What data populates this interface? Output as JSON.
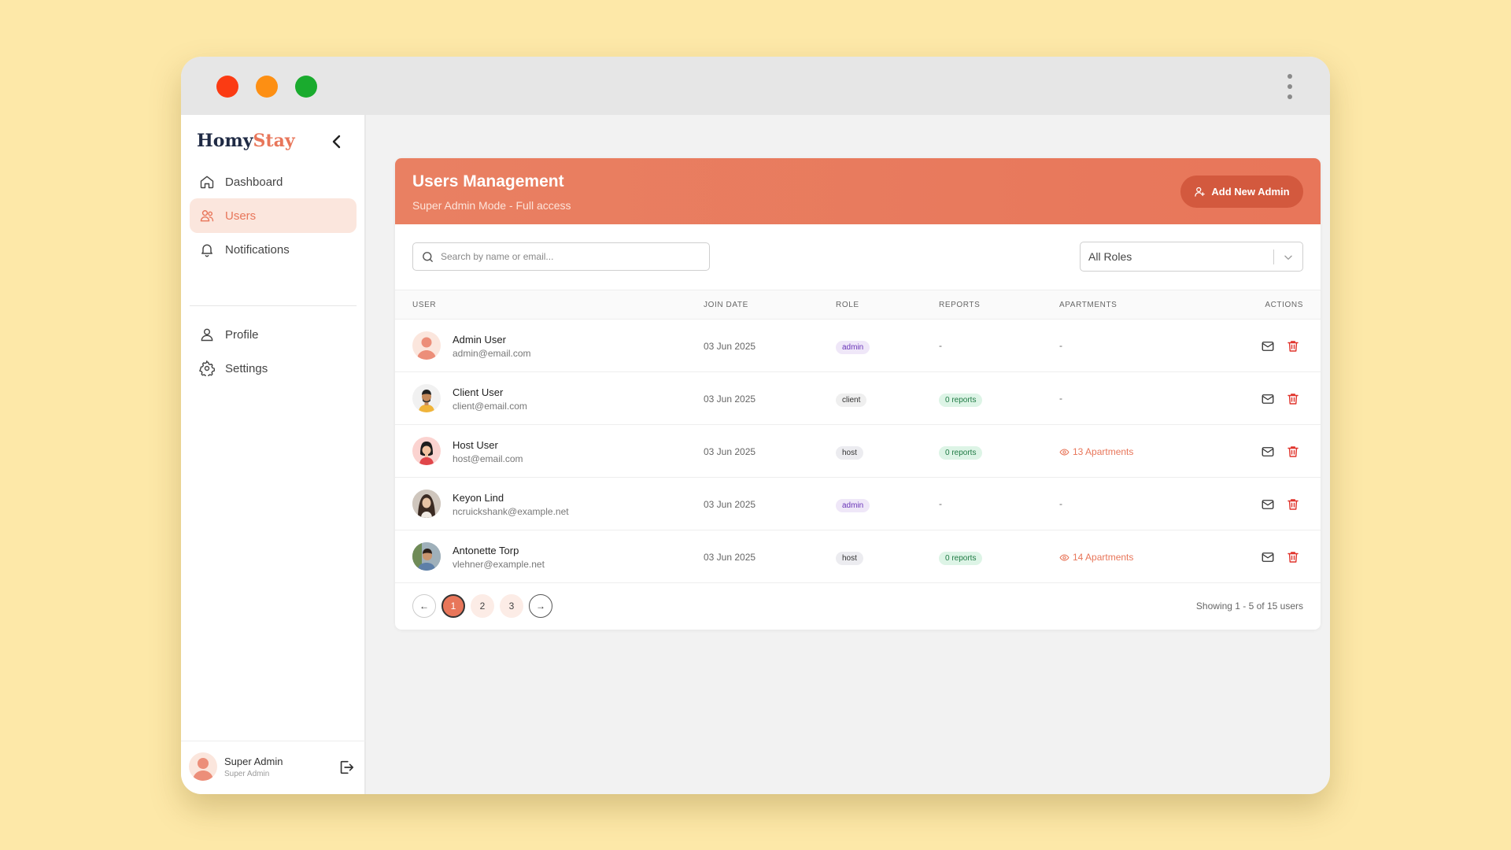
{
  "window": {
    "dots": [
      "red",
      "orange",
      "green"
    ]
  },
  "sidebar": {
    "logo_a": "Homy",
    "logo_b": "Stay",
    "items": [
      {
        "label": "Dashboard",
        "icon": "home-icon"
      },
      {
        "label": "Users",
        "icon": "users-icon",
        "active": true
      },
      {
        "label": "Notifications",
        "icon": "bell-icon"
      },
      {
        "label": "Profile",
        "icon": "user-icon"
      },
      {
        "label": "Settings",
        "icon": "gear-icon"
      }
    ],
    "footer": {
      "name": "Super Admin",
      "role": "Super Admin"
    }
  },
  "header": {
    "title": "Users Management",
    "subtitle": "Super Admin Mode - Full access",
    "add_button": "Add New Admin"
  },
  "filters": {
    "search_placeholder": "Search by name or email...",
    "role_select": "All Roles"
  },
  "table": {
    "columns": [
      "USER",
      "JOIN DATE",
      "ROLE",
      "REPORTS",
      "APARTMENTS",
      "ACTIONS"
    ],
    "rows": [
      {
        "name": "Admin User",
        "email": "admin@email.com",
        "join": "03 Jun 2025",
        "role": "admin",
        "reports": "-",
        "apartments": "-"
      },
      {
        "name": "Client User",
        "email": "client@email.com",
        "join": "03 Jun 2025",
        "role": "client",
        "reports": "0 reports",
        "apartments": "-"
      },
      {
        "name": "Host User",
        "email": "host@email.com",
        "join": "03 Jun 2025",
        "role": "host",
        "reports": "0 reports",
        "apartments": "13 Apartments"
      },
      {
        "name": "Keyon Lind",
        "email": "ncruickshank@example.net",
        "join": "03 Jun 2025",
        "role": "admin",
        "reports": "-",
        "apartments": "-"
      },
      {
        "name": "Antonette Torp",
        "email": "vlehner@example.net",
        "join": "03 Jun 2025",
        "role": "host",
        "reports": "0 reports",
        "apartments": "14 Apartments"
      }
    ]
  },
  "pagination": {
    "prev": "←",
    "next": "→",
    "pages": [
      "1",
      "2",
      "3"
    ],
    "current": "1",
    "showing": "Showing 1 - 5 of 15 users"
  },
  "colors": {
    "accent": "#e8765a",
    "accent_dark": "#d3593e",
    "delete": "#e0342c",
    "background": "#fde8a8"
  }
}
